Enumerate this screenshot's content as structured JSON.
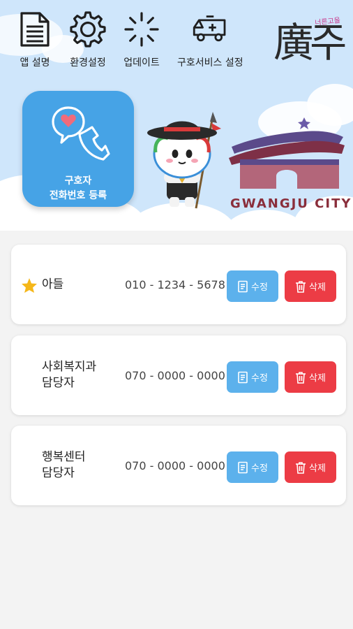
{
  "toolbar": {
    "items": [
      {
        "label": "앱 설명",
        "icon": "document-icon"
      },
      {
        "label": "환경설정",
        "icon": "gear-icon"
      },
      {
        "label": "업데이트",
        "icon": "loading-icon"
      },
      {
        "label": "구호서비스 설정",
        "icon": "ambulance-icon"
      }
    ]
  },
  "logo": {
    "main": "廣주",
    "sub": "너른고을"
  },
  "register": {
    "line1": "구호자",
    "line2": "전화번호 등록"
  },
  "banner": {
    "city_name": "GWANGJU CITY"
  },
  "contacts": [
    {
      "name": "아들",
      "phone": "010 - 1234 - 5678",
      "starred": true
    },
    {
      "name": "사회복지과\n담당자",
      "name_line1": "사회복지과",
      "name_line2": "담당자",
      "phone": "070 - 0000 - 0000",
      "starred": false
    },
    {
      "name": "행복센터\n담당자",
      "name_line1": "행복센터",
      "name_line2": "담당자",
      "phone": "070 - 0000 - 0000",
      "starred": false
    }
  ],
  "buttons": {
    "edit_label": "수정",
    "delete_label": "삭제"
  },
  "colors": {
    "header_bg": "#cfe6fb",
    "tile_blue": "#46a3e6",
    "edit_blue": "#5cb1ec",
    "delete_red": "#ec3c45",
    "star_yellow": "#f5b719"
  }
}
